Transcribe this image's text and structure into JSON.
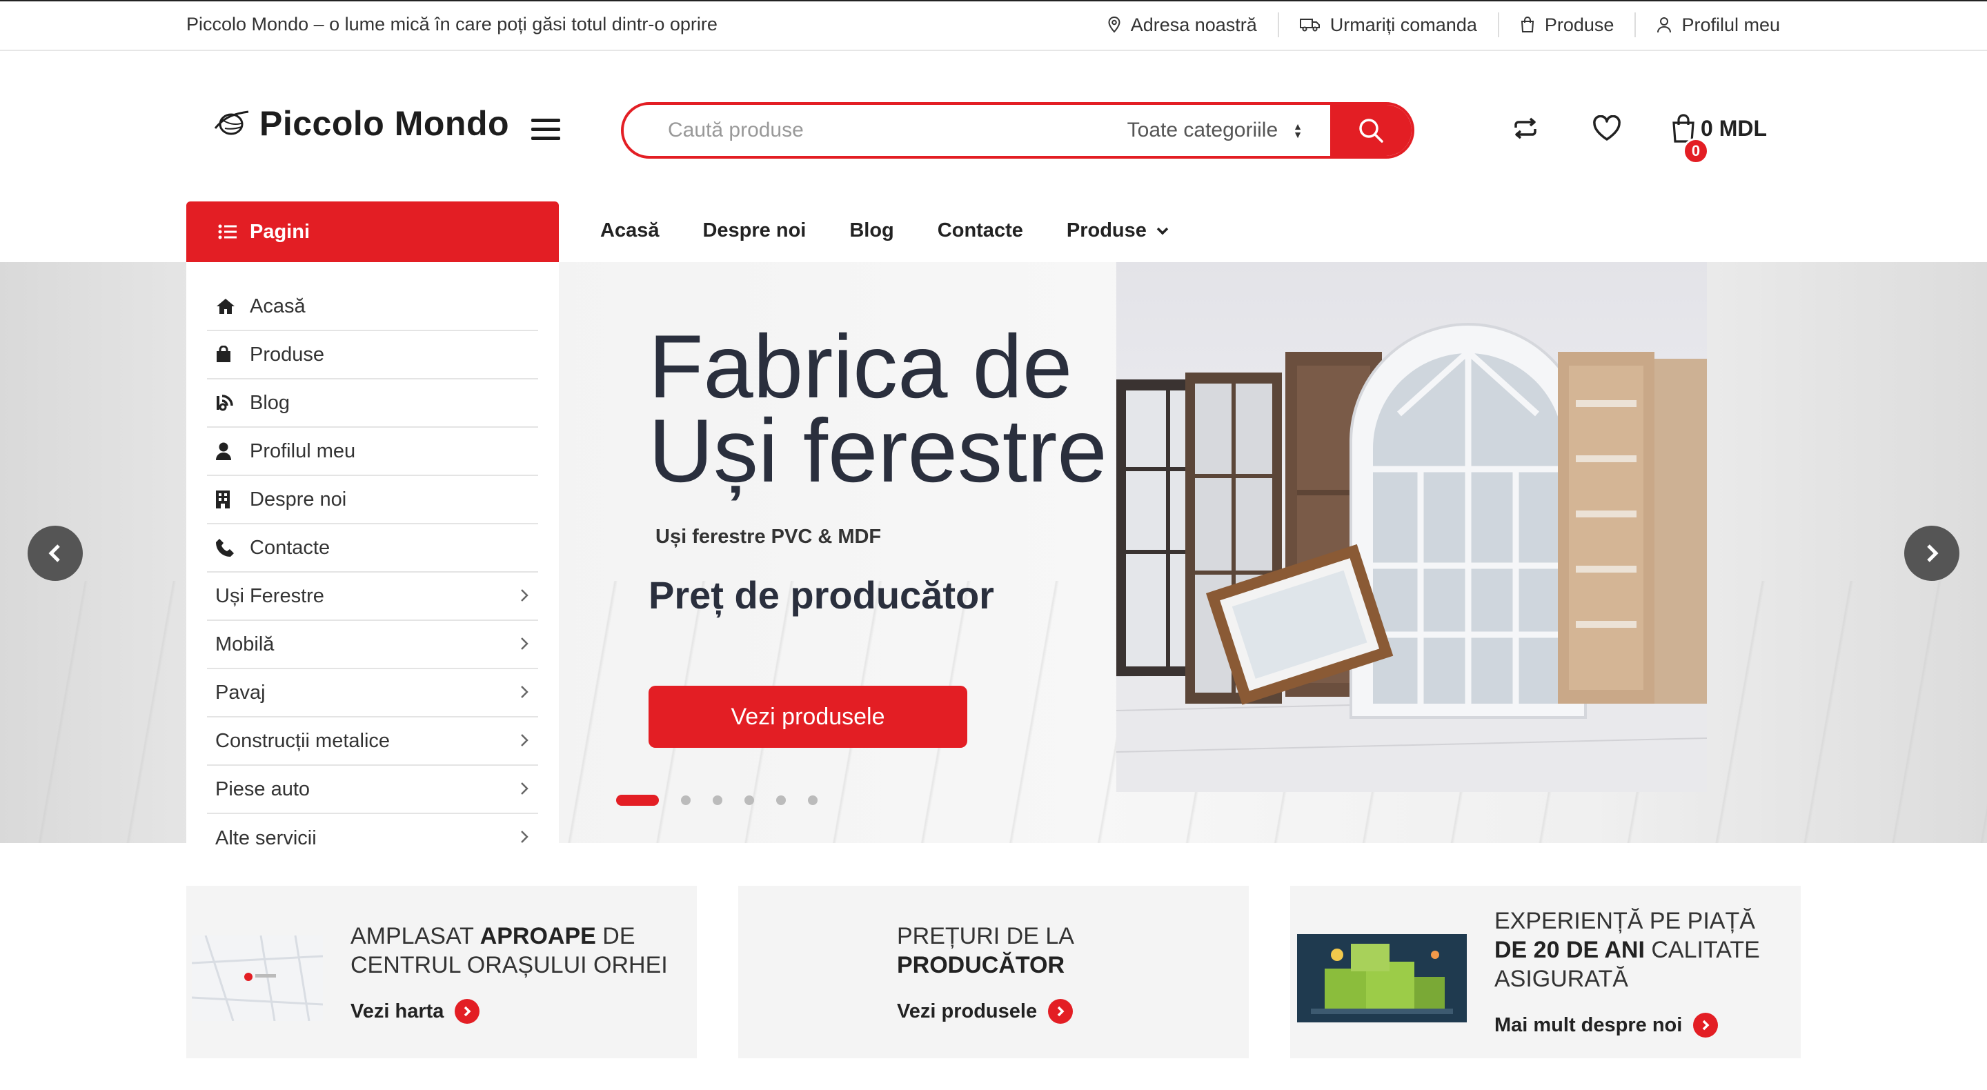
{
  "topbar": {
    "tagline": "Piccolo Mondo – o lume mică în care poți găsi totul dintr-o oprire",
    "links": [
      {
        "label": "Adresa noastră",
        "icon": "map-pin-icon"
      },
      {
        "label": "Urmariți comanda",
        "icon": "truck-icon"
      },
      {
        "label": "Produse",
        "icon": "bag-icon"
      },
      {
        "label": "Profilul meu",
        "icon": "user-icon"
      }
    ]
  },
  "header": {
    "logo": "Piccolo Mondo",
    "search_placeholder": "Caută produse",
    "category_select": "Toate categoriile",
    "cart_count": "0",
    "cart_total": "0 MDL"
  },
  "nav": {
    "pages_button": "Pagini",
    "links": [
      "Acasă",
      "Despre noi",
      "Blog",
      "Contacte",
      "Produse"
    ]
  },
  "sidemenu": {
    "items": [
      {
        "label": "Acasă",
        "icon": "home-icon"
      },
      {
        "label": "Produse",
        "icon": "shopping-bag-icon"
      },
      {
        "label": "Blog",
        "icon": "blog-icon"
      },
      {
        "label": "Profilul meu",
        "icon": "user-icon"
      },
      {
        "label": "Despre noi",
        "icon": "building-icon"
      },
      {
        "label": "Contacte",
        "icon": "phone-icon"
      },
      {
        "label": "Uși Ferestre",
        "icon": "chevron-right-icon"
      },
      {
        "label": "Mobilă",
        "icon": "chevron-right-icon"
      },
      {
        "label": "Pavaj",
        "icon": "chevron-right-icon"
      },
      {
        "label": "Construcții metalice",
        "icon": "chevron-right-icon"
      },
      {
        "label": "Piese auto",
        "icon": "chevron-right-icon"
      },
      {
        "label": "Alte servicii",
        "icon": "chevron-right-icon"
      }
    ]
  },
  "slider": {
    "title_line1": "Fabrica de",
    "title_line2": "Uși ferestre",
    "subtitle": "Uși ferestre PVC & MDF",
    "price_text": "Preț de producător",
    "button": "Vezi produsele",
    "active_slide": 1,
    "slide_count": 6
  },
  "features": [
    {
      "text_pre": "Amplasat ",
      "text_bold": "aproape",
      "text_post": " de centrul orașului Orhei",
      "link": "Vezi harta"
    },
    {
      "text_pre": "Prețuri de la ",
      "text_bold": "producător",
      "text_post": "",
      "link": "Vezi produsele"
    },
    {
      "text_pre": "Experiență pe piață ",
      "text_bold": "de 20 de ani",
      "text_post": " calitate asigurată",
      "link": "Mai mult despre noi"
    }
  ],
  "colors": {
    "accent": "#e31e24",
    "dark": "#2a2f3d"
  }
}
